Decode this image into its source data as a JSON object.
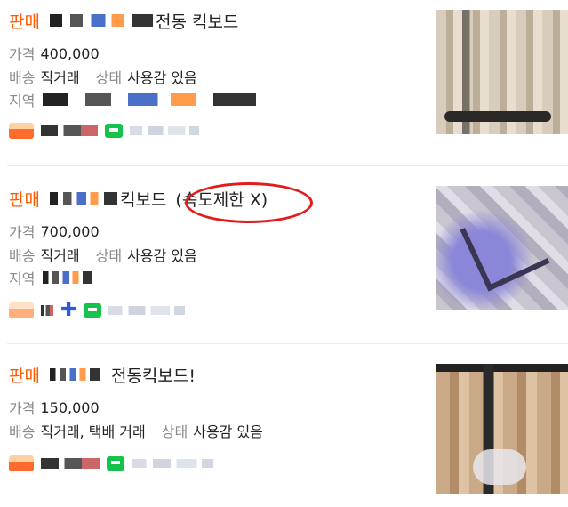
{
  "listings": [
    {
      "sale_tag": "판매",
      "title": "전동 킥보드",
      "price_label": "가격",
      "price": "400,000",
      "shipping_label": "배송",
      "shipping": "직거래",
      "condition_label": "상태",
      "condition": "사용감 있음",
      "region_label": "지역"
    },
    {
      "sale_tag": "판매",
      "title": "킥보드",
      "highlight": "(속도제한 X)",
      "price_label": "가격",
      "price": "700,000",
      "shipping_label": "배송",
      "shipping": "직거래",
      "condition_label": "상태",
      "condition": "사용감 있음",
      "region_label": "지역"
    },
    {
      "sale_tag": "판매",
      "title": "전동킥보드!",
      "price_label": "가격",
      "price": "150,000",
      "shipping_label": "배송",
      "shipping": "직거래, 택배 거래",
      "condition_label": "상태",
      "condition": "사용감 있음"
    }
  ],
  "colors": {
    "sale_tag": "#ff5a00",
    "annotation_circle": "#e21b1b",
    "talk_icon": "#15c24a"
  }
}
